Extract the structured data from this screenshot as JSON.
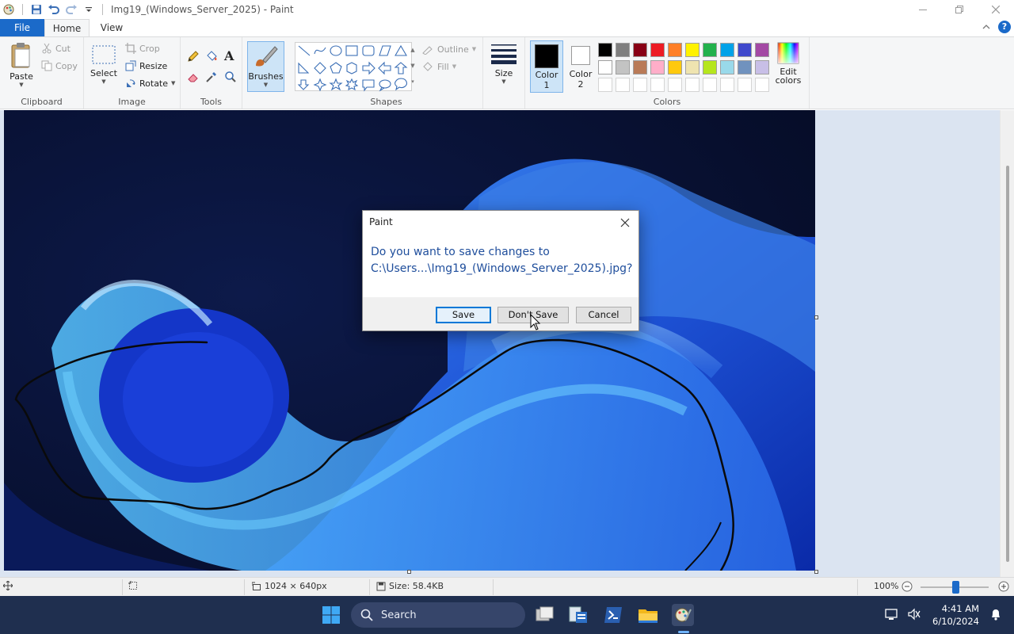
{
  "window": {
    "title": "Img19_(Windows_Server_2025) - Paint"
  },
  "tabs": {
    "file": "File",
    "home": "Home",
    "view": "View"
  },
  "ribbon": {
    "clipboard": {
      "label": "Clipboard",
      "paste": "Paste",
      "cut": "Cut",
      "copy": "Copy"
    },
    "image": {
      "label": "Image",
      "select": "Select",
      "crop": "Crop",
      "resize": "Resize",
      "rotate": "Rotate"
    },
    "tools": {
      "label": "Tools"
    },
    "brushes": {
      "label": "Brushes"
    },
    "shapes": {
      "label": "Shapes",
      "outline": "Outline",
      "fill": "Fill"
    },
    "size": {
      "label": "Size"
    },
    "colors": {
      "label": "Colors",
      "color1_line1": "Color",
      "color1_line2": "1",
      "color2_line1": "Color",
      "color2_line2": "2",
      "edit_line1": "Edit",
      "edit_line2": "colors",
      "color1_value": "#000000",
      "color2_value": "#ffffff",
      "palette_row1": [
        "#000000",
        "#7f7f7f",
        "#880015",
        "#ed1c24",
        "#ff7f27",
        "#fff200",
        "#22b14c",
        "#00a2e8",
        "#3f48cc",
        "#a349a4"
      ],
      "palette_row2": [
        "#ffffff",
        "#c3c3c3",
        "#b97a57",
        "#ffaec9",
        "#ffc90e",
        "#efe4b0",
        "#b5e61d",
        "#99d9ea",
        "#7092be",
        "#c8bfe7"
      ]
    }
  },
  "status": {
    "dimensions": "1024 × 640px",
    "size": "Size: 58.4KB",
    "zoom": "100%"
  },
  "dialog": {
    "title": "Paint",
    "message_line1": "Do you want to save changes to",
    "message_line2": "C:\\Users...\\Img19_(Windows_Server_2025).jpg?",
    "save": "Save",
    "dont_save": "Don't Save",
    "cancel": "Cancel"
  },
  "taskbar": {
    "search": "Search",
    "time": "4:41 AM",
    "date": "6/10/2024"
  }
}
